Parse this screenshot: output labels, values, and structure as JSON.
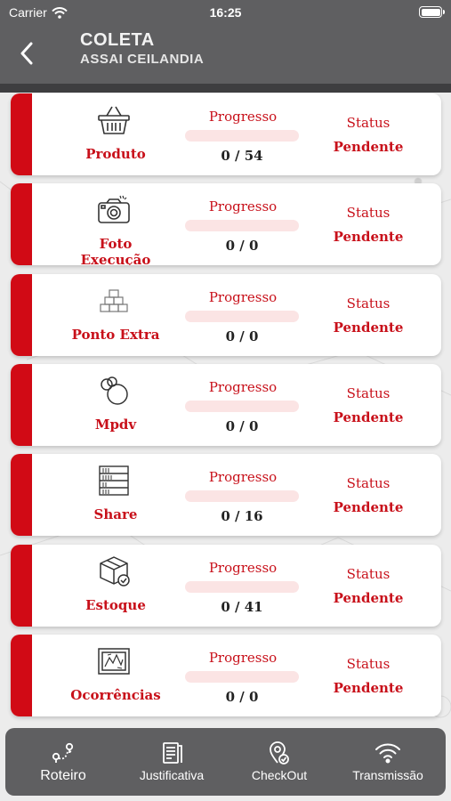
{
  "status_bar": {
    "carrier": "Carrier",
    "time": "16:25"
  },
  "header": {
    "title": "COLETA",
    "subtitle": "ASSAI CEILANDIA"
  },
  "cards": [
    {
      "name": "Produto",
      "icon": "basket-icon",
      "progress_label": "Progresso",
      "count": "0 / 54",
      "progress": 0,
      "status_label": "Status",
      "status": "Pendente"
    },
    {
      "name": "Foto Execução",
      "icon": "camera-icon",
      "progress_label": "Progresso",
      "count": "0 / 0",
      "progress": 0,
      "status_label": "Status",
      "status": "Pendente"
    },
    {
      "name": "Ponto Extra",
      "icon": "boxes-stack-icon",
      "progress_label": "Progresso",
      "count": "0 / 0",
      "progress": 0,
      "status_label": "Status",
      "status": "Pendente"
    },
    {
      "name": "Mpdv",
      "icon": "circles-icon",
      "progress_label": "Progresso",
      "count": "0 / 0",
      "progress": 0,
      "status_label": "Status",
      "status": "Pendente"
    },
    {
      "name": "Share",
      "icon": "shelf-icon",
      "progress_label": "Progresso",
      "count": "0 / 16",
      "progress": 0,
      "status_label": "Status",
      "status": "Pendente"
    },
    {
      "name": "Estoque",
      "icon": "box-check-icon",
      "progress_label": "Progresso",
      "count": "0 / 41",
      "progress": 0,
      "status_label": "Status",
      "status": "Pendente"
    },
    {
      "name": "Ocorrências",
      "icon": "broken-frame-icon",
      "progress_label": "Progresso",
      "count": "0 / 0",
      "progress": 0,
      "status_label": "Status",
      "status": "Pendente"
    }
  ],
  "tabs": [
    {
      "label": "Roteiro",
      "icon": "route-icon",
      "active": true
    },
    {
      "label": "Justificativa",
      "icon": "document-icon",
      "active": false
    },
    {
      "label": "CheckOut",
      "icon": "location-check-icon",
      "active": false
    },
    {
      "label": "Transmissão",
      "icon": "wifi-icon",
      "active": false
    }
  ],
  "colors": {
    "accent": "#d10a15",
    "header": "#5f5f61",
    "bar_track": "#fbe4e4"
  }
}
